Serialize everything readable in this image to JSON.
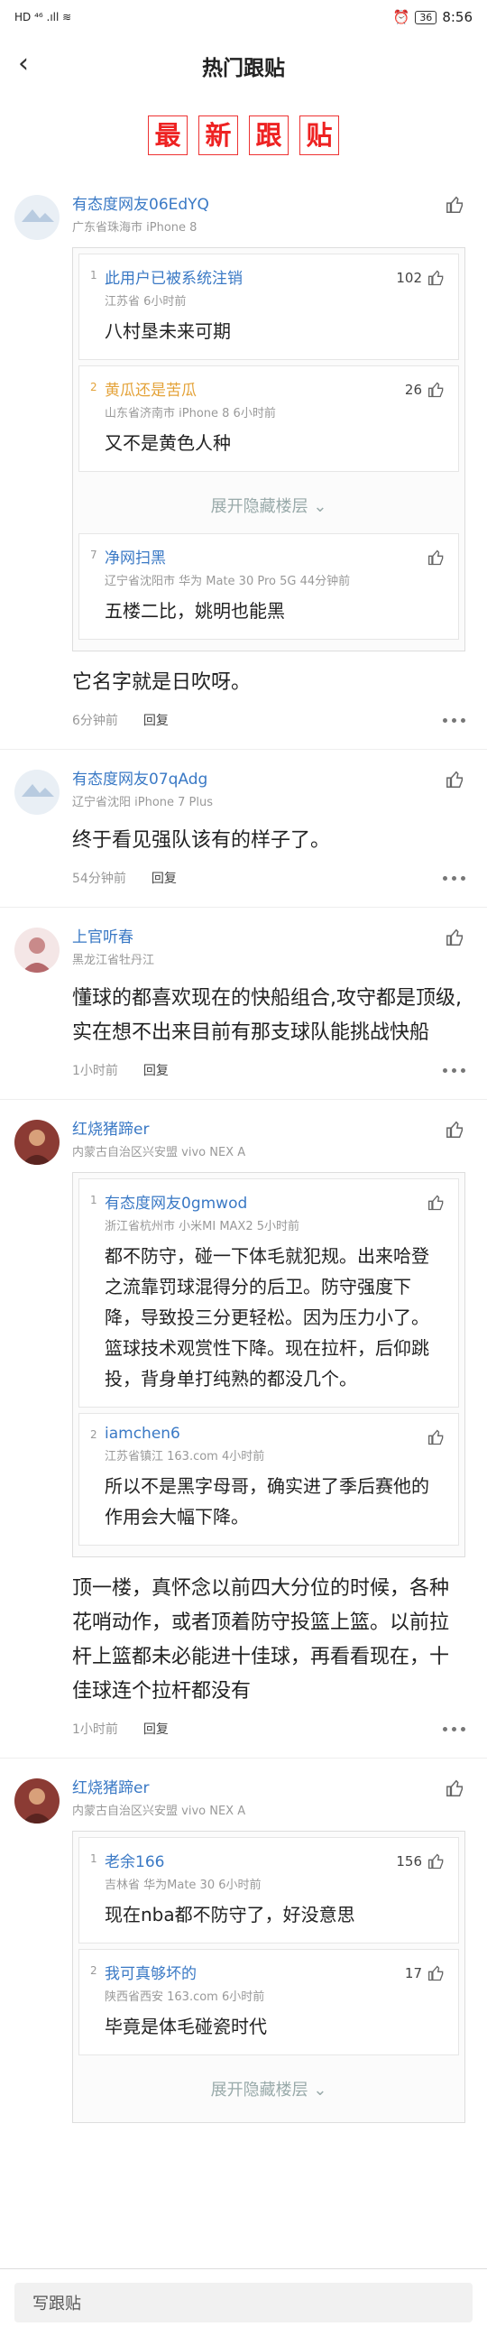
{
  "status": {
    "left": "HD ⁴⁶ .ıll ≋",
    "time": "8:56",
    "battery": "36"
  },
  "header": {
    "title": "热门跟贴"
  },
  "banner": [
    "最",
    "新",
    "跟",
    "贴"
  ],
  "posts": [
    {
      "user": "有态度网友06EdYQ",
      "meta": "广东省珠海市  iPhone 8",
      "quotes": [
        {
          "num": "1",
          "name": "此用户已被系统注销",
          "meta": "江苏省  6小时前",
          "likes": "102",
          "text": "八村垦未来可期"
        },
        {
          "num": "2",
          "name": "黄瓜还是苦瓜",
          "meta": "山东省济南市  iPhone 8  6小时前",
          "likes": "26",
          "text": "又不是黄色人种"
        }
      ],
      "expand": "展开隐藏楼层",
      "quote7": {
        "num": "7",
        "name": "净网扫黑",
        "meta": "辽宁省沈阳市  华为 Mate 30 Pro 5G  44分钟前",
        "likes": "",
        "text": "五楼二比，姚明也能黑"
      },
      "content": "它名字就是日吹呀。",
      "time": "6分钟前",
      "reply": "回复"
    },
    {
      "user": "有态度网友07qAdg",
      "meta": "辽宁省沈阳  iPhone 7 Plus",
      "content": "终于看见强队该有的样子了。",
      "time": "54分钟前",
      "reply": "回复"
    },
    {
      "user": "上官听春",
      "meta": "黑龙江省牡丹江",
      "content": "懂球的都喜欢现在的快船组合,攻守都是顶级,实在想不出来目前有那支球队能挑战快船",
      "time": "1小时前",
      "reply": "回复"
    },
    {
      "user": "红烧猪蹄er",
      "meta": "内蒙古自治区兴安盟  vivo NEX A",
      "quotes": [
        {
          "num": "1",
          "name": "有态度网友0gmwod",
          "meta": "浙江省杭州市  小米MI MAX2  5小时前",
          "likes": "",
          "text": "都不防守，碰一下体毛就犯规。出来哈登之流靠罚球混得分的后卫。防守强度下降，导致投三分更轻松。因为压力小了。篮球技术观赏性下降。现在拉杆，后仰跳投，背身单打纯熟的都没几个。"
        },
        {
          "num": "2",
          "name": "iamchen6",
          "meta": "江苏省镇江  163.com  4小时前",
          "likes": "",
          "text": "所以不是黑字母哥，确实进了季后赛他的作用会大幅下降。"
        }
      ],
      "content": "顶一楼，真怀念以前四大分位的时候，各种花哨动作，或者顶着防守投篮上篮。以前拉杆上篮都未必能进十佳球，再看看现在，十佳球连个拉杆都没有",
      "time": "1小时前",
      "reply": "回复"
    },
    {
      "user": "红烧猪蹄er",
      "meta": "内蒙古自治区兴安盟  vivo NEX A",
      "quotes": [
        {
          "num": "1",
          "name": "老余166",
          "meta": "吉林省  华为Mate 30  6小时前",
          "likes": "156",
          "text": "现在nba都不防守了，好没意思"
        },
        {
          "num": "2",
          "name": "我可真够坏的",
          "meta": "陕西省西安  163.com  6小时前",
          "likes": "17",
          "text": "毕竟是体毛碰瓷时代"
        }
      ],
      "expand": "展开隐藏楼层"
    }
  ],
  "bottom": {
    "placeholder": "写跟贴"
  }
}
